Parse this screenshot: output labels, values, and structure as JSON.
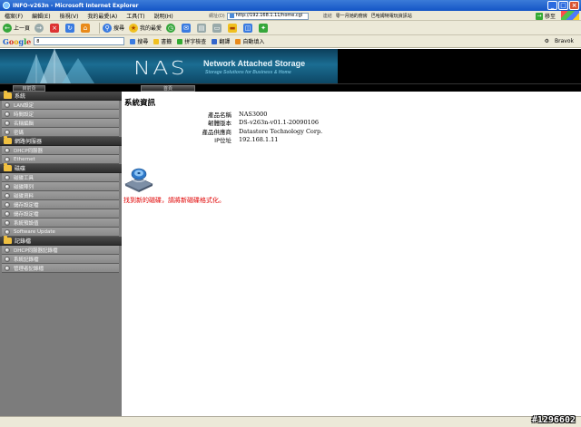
{
  "window": {
    "title": "INFO-v263n - Microsoft Internet Explorer",
    "min": "_",
    "max": "□",
    "close": "×"
  },
  "menu": [
    "檔案(F)",
    "編輯(E)",
    "檢視(V)",
    "我的最愛(A)",
    "工具(T)",
    "說明(H)"
  ],
  "address": {
    "label": "網址(D)",
    "url": "http://192.168.1.11/home.cgi",
    "go_label": "移至"
  },
  "links": {
    "label": "連結",
    "items": [
      "零一月她的廚房",
      "巴哈姆特電玩資訊站"
    ]
  },
  "toolbar": {
    "back": "上一頁",
    "search": "搜尋",
    "favorites": "我的最愛"
  },
  "googlebar": {
    "logo": [
      "G",
      "o",
      "o",
      "g",
      "l",
      "e"
    ],
    "items": [
      "搜尋",
      "書籤",
      "拼字檢查",
      "翻譯",
      "自動填入"
    ],
    "right": [
      "Bravok"
    ]
  },
  "header": {
    "logo": "NAS",
    "title": "Network Attached Storage",
    "subtitle": "Storage Solutions for Business & Home",
    "nav_left": "目前頁",
    "nav_right": "首頁"
  },
  "sidebar": {
    "groups": [
      {
        "label": "系統",
        "items": [
          "LAN設定",
          "時間設定",
          "名稱編輯",
          "密碼"
        ]
      },
      {
        "label": "網路伺服器",
        "items": [
          "DHCP伺服器",
          "Ethernet"
        ]
      },
      {
        "label": "磁碟",
        "items": [
          "磁碟工具",
          "磁碟陣列",
          "磁碟資料",
          "儲存設定檔",
          "儲存設定檔",
          "系統預設值",
          "Software Update"
        ]
      },
      {
        "label": "記錄檔",
        "items": [
          "DHCP伺服器記錄檔",
          "系統記錄檔",
          "管理者記錄檔"
        ]
      }
    ]
  },
  "main": {
    "title": "系統資訊",
    "info": [
      {
        "label": "產品名稱",
        "value": "NAS3000"
      },
      {
        "label": "韌體版本",
        "value": "DS-v263n-v01.1-20090106"
      },
      {
        "label": "產品供應商",
        "value": "Datastore Technology Corp."
      },
      {
        "label": "IP位址",
        "value": "192.168.1.11"
      }
    ],
    "disk_message": "找到新的磁碟，請將新磁碟格式化。"
  },
  "watermark": "#1296602",
  "colors": {
    "sidebar_bg": "#7c7c7c",
    "banner": "#1b6d92",
    "alert": "#e00000"
  }
}
